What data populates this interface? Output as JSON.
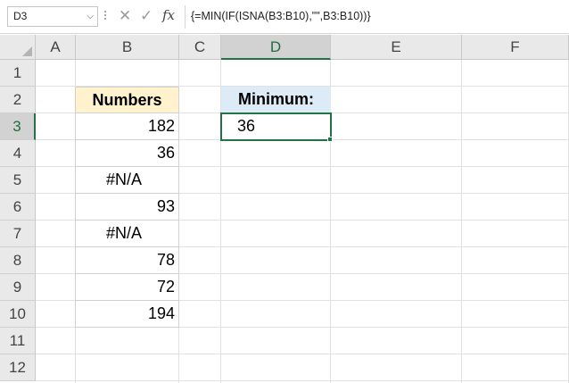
{
  "formula_bar": {
    "name_box": "D3",
    "cancel_icon": "✕",
    "enter_icon": "✓",
    "fx_label": "fx",
    "formula": "{=MIN(IF(ISNA(B3:B10),\"\",B3:B10))}"
  },
  "columns": [
    "A",
    "B",
    "C",
    "D",
    "E",
    "F"
  ],
  "rows": [
    "1",
    "2",
    "3",
    "4",
    "5",
    "6",
    "7",
    "8",
    "9",
    "10",
    "11",
    "12"
  ],
  "sheet": {
    "numbers_header": "Numbers",
    "numbers": [
      "182",
      "36",
      "#N/A",
      "93",
      "#N/A",
      "78",
      "72",
      "194"
    ],
    "minimum_label": "Minimum:",
    "minimum_value": "36"
  },
  "colors": {
    "accent": "#217346",
    "header_fill": "#fff2cc",
    "label_fill": "#ddebf7"
  }
}
